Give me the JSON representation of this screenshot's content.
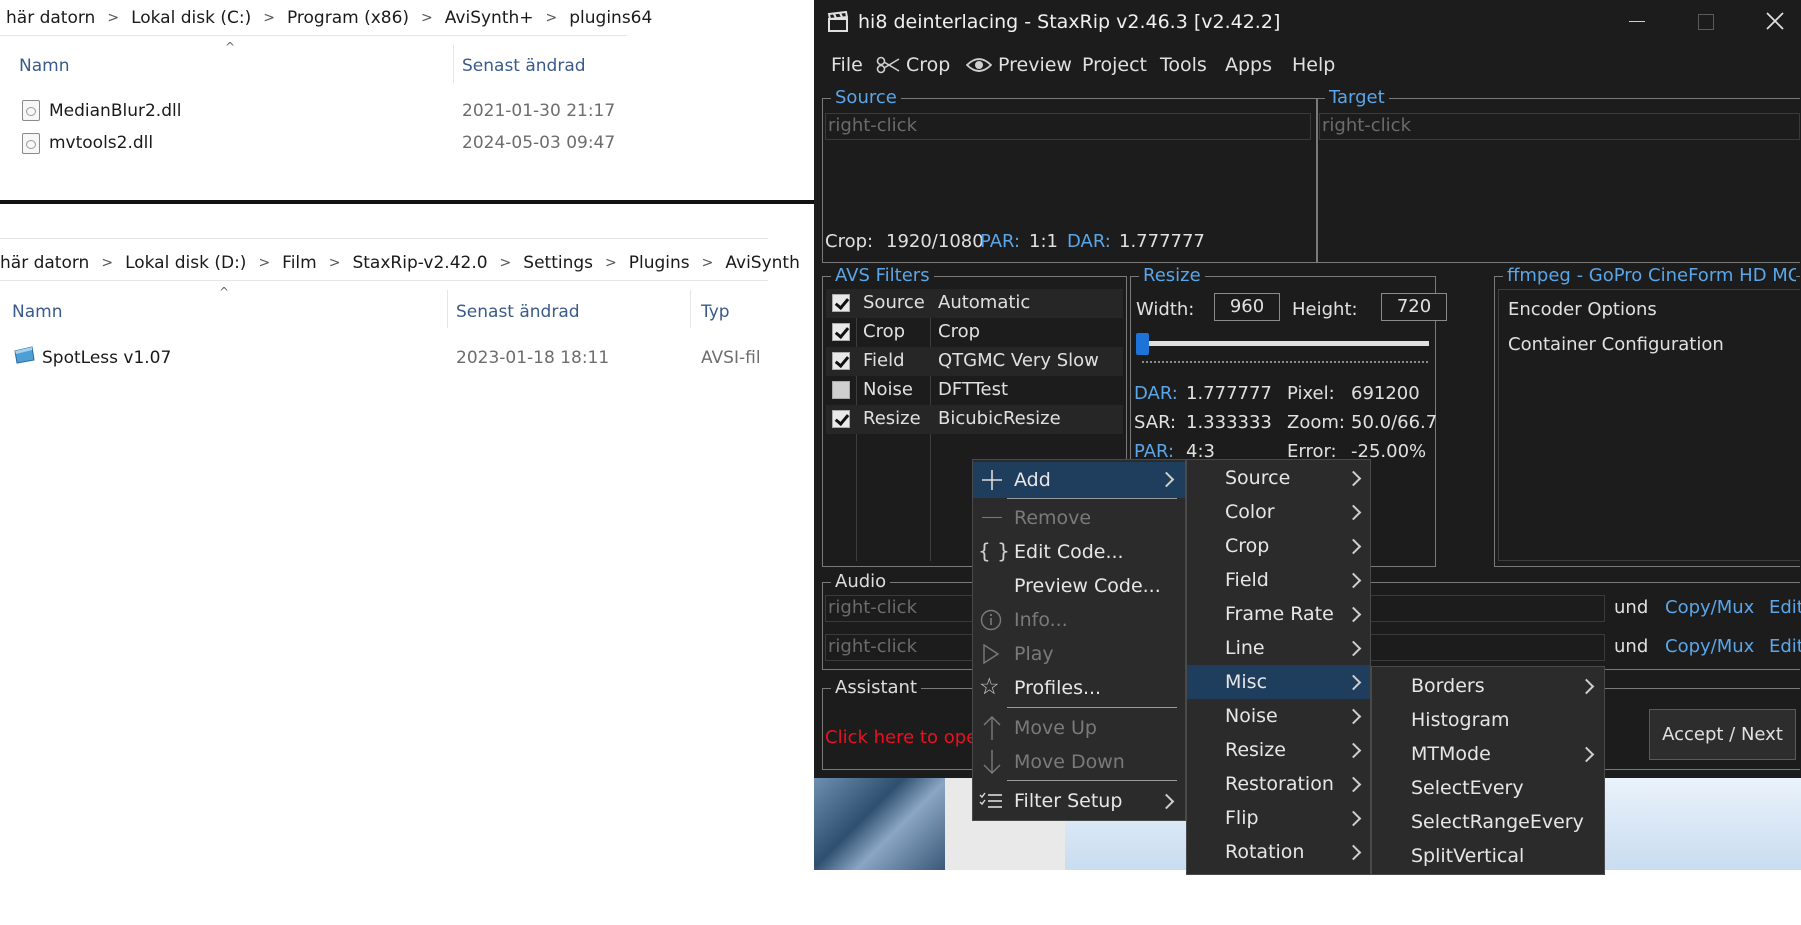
{
  "explorer_top": {
    "breadcrumb": [
      "här datorn",
      "Lokal disk (C:)",
      "Program (x86)",
      "AviSynth+",
      "plugins64"
    ],
    "columns": [
      "Namn",
      "Senast ändrad"
    ],
    "files": [
      {
        "name": "MedianBlur2.dll",
        "modified": "2021-01-30 21:17"
      },
      {
        "name": "mvtools2.dll",
        "modified": "2024-05-03 09:47"
      }
    ]
  },
  "explorer_bottom": {
    "breadcrumb": [
      "här datorn",
      "Lokal disk (D:)",
      "Film",
      "StaxRip-v2.42.0",
      "Settings",
      "Plugins",
      "AviSynth"
    ],
    "columns": [
      "Namn",
      "Senast ändrad",
      "Typ"
    ],
    "files": [
      {
        "name": "SpotLess v1.07",
        "modified": "2023-01-18 18:11",
        "type": "AVSI-fil"
      }
    ]
  },
  "staxrip": {
    "title": "hi8 deinterlacing - StaxRip v2.46.3 [v2.42.2]",
    "menu": [
      "File",
      "Crop",
      "Preview",
      "Project",
      "Tools",
      "Apps",
      "Help"
    ],
    "source": {
      "label": "Source",
      "placeholder": "right-click",
      "crop_label": "Crop:",
      "crop_value": "1920/1080",
      "par_label": "PAR:",
      "par_value": "1:1",
      "dar_label": "DAR:",
      "dar_value": "1.777777"
    },
    "target": {
      "label": "Target",
      "placeholder": "right-click"
    },
    "avs_filters": {
      "label": "AVS Filters",
      "rows": [
        {
          "category": "Source",
          "filter": "Automatic",
          "checked": true
        },
        {
          "category": "Crop",
          "filter": "Crop",
          "checked": true
        },
        {
          "category": "Field",
          "filter": "QTGMC Very Slow",
          "checked": true
        },
        {
          "category": "Noise",
          "filter": "DFTTest",
          "checked": false
        },
        {
          "category": "Resize",
          "filter": "BicubicResize",
          "checked": true
        }
      ]
    },
    "resize": {
      "label": "Resize",
      "width_label": "Width:",
      "width": "960",
      "height_label": "Height:",
      "height": "720",
      "dar_label": "DAR:",
      "dar": "1.777777",
      "pixel_label": "Pixel:",
      "pixel": "691200",
      "sar_label": "SAR:",
      "sar": "1.333333",
      "zoom_label": "Zoom:",
      "zoom": "50.0/66.7",
      "par_label": "PAR:",
      "par": "4:3",
      "error_label": "Error:",
      "error": "-25.00%"
    },
    "encoder": {
      "label": "ffmpeg - GoPro CineForm HD MOV",
      "encoder_options": "Encoder Options",
      "container_config": "Container Configuration"
    },
    "audio": {
      "label": "Audio",
      "placeholder": "right-click",
      "tracks": [
        {
          "lang": "und",
          "codec": "Copy/Mux",
          "edit": "Edit"
        },
        {
          "lang": "und",
          "codec": "Copy/Mux",
          "edit": "Edit"
        }
      ]
    },
    "assistant": {
      "label": "Assistant",
      "text": "Click here to open",
      "button": "Accept / Next"
    }
  },
  "context_menu": {
    "items": [
      {
        "label": "Add",
        "icon": "plus-icon",
        "enabled": true,
        "submenu": true,
        "highlighted": true
      },
      {
        "label": "Remove",
        "icon": "minus-icon",
        "enabled": false
      },
      {
        "label": "Edit Code...",
        "icon": "braces-icon",
        "enabled": true
      },
      {
        "label": "Preview Code...",
        "icon": "",
        "enabled": true
      },
      {
        "label": "Info...",
        "icon": "info-icon",
        "enabled": false
      },
      {
        "label": "Play",
        "icon": "play-icon",
        "enabled": false
      },
      {
        "label": "Profiles...",
        "icon": "star-icon",
        "enabled": true
      },
      {
        "label": "Move Up",
        "icon": "arrow-up-icon",
        "enabled": false
      },
      {
        "label": "Move Down",
        "icon": "arrow-down-icon",
        "enabled": false
      },
      {
        "label": "Filter Setup",
        "icon": "list-icon",
        "enabled": true,
        "submenu": true
      }
    ]
  },
  "add_submenu": {
    "items": [
      "Source",
      "Color",
      "Crop",
      "Field",
      "Frame Rate",
      "Line",
      "Misc",
      "Noise",
      "Resize",
      "Restoration",
      "Flip",
      "Rotation"
    ],
    "highlighted": "Misc"
  },
  "misc_submenu": {
    "items": [
      {
        "label": "Borders",
        "submenu": true
      },
      {
        "label": "Histogram",
        "submenu": false
      },
      {
        "label": "MTMode",
        "submenu": true
      },
      {
        "label": "SelectEvery",
        "submenu": false
      },
      {
        "label": "SelectRangeEvery",
        "submenu": false
      },
      {
        "label": "SplitVertical",
        "submenu": false
      }
    ]
  },
  "colors": {
    "accent": "#5aa6e8",
    "highlight": "#1f3d5c",
    "window_bg": "#1c1c1c",
    "warning": "#e81123"
  }
}
